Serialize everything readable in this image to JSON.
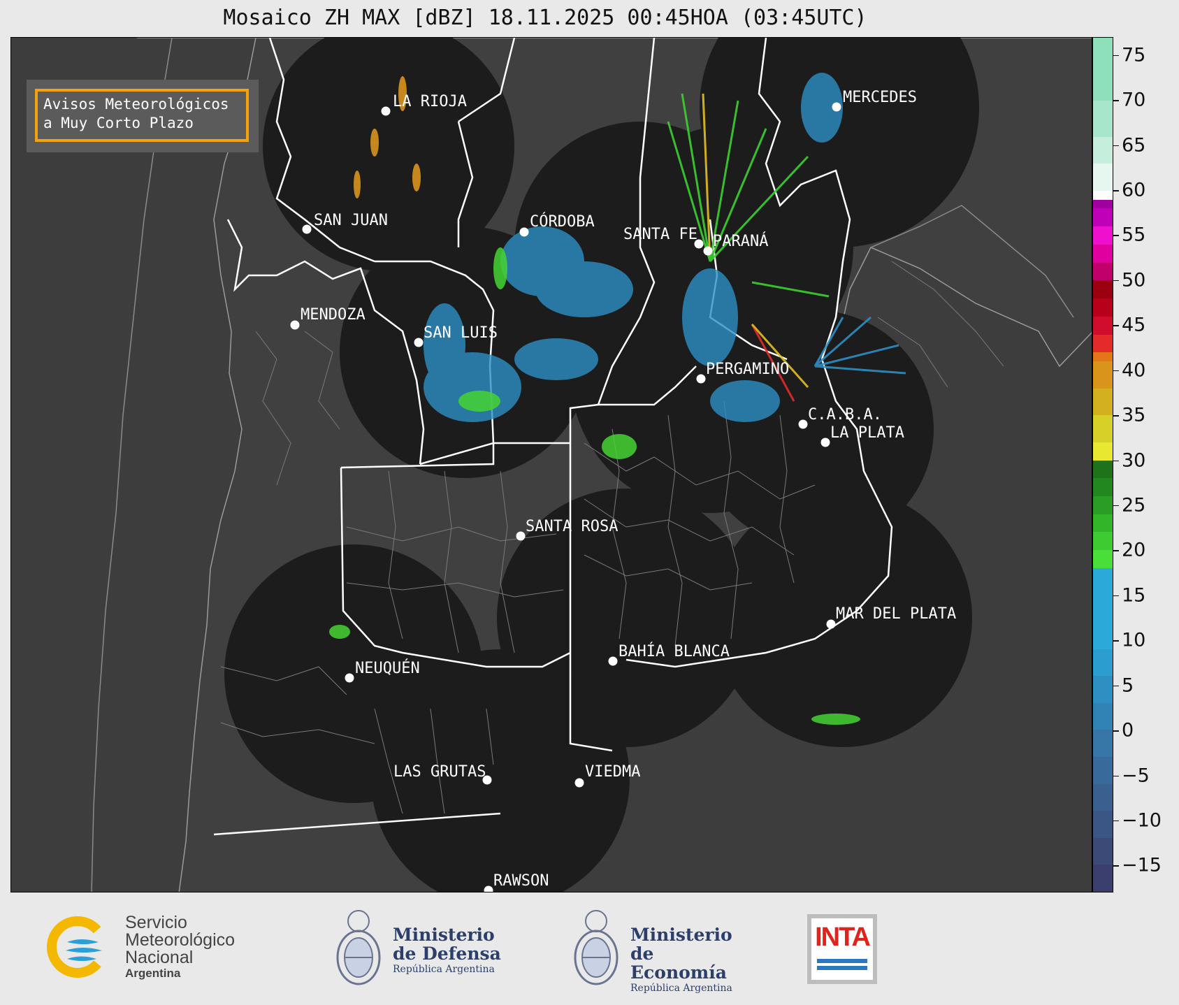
{
  "title": "Mosaico ZH MAX [dBZ] 18.11.2025 00:45HOA (03:45UTC)",
  "notice": {
    "line1": "Avisos Meteorológicos",
    "line2": "a Muy Corto Plazo",
    "border_color": "#f2a20c"
  },
  "cities": [
    {
      "name": "LA RIOJA"
    },
    {
      "name": "SAN JUAN"
    },
    {
      "name": "CÓRDOBA"
    },
    {
      "name": "SANTA FE"
    },
    {
      "name": "PARANÁ"
    },
    {
      "name": "MENDOZA"
    },
    {
      "name": "SAN LUIS"
    },
    {
      "name": "MERCEDES"
    },
    {
      "name": "PERGAMINO"
    },
    {
      "name": "C.A.B.A."
    },
    {
      "name": "LA PLATA"
    },
    {
      "name": "SANTA ROSA"
    },
    {
      "name": "MAR DEL PLATA"
    },
    {
      "name": "BAHÍA BLANCA"
    },
    {
      "name": "NEUQUÉN"
    },
    {
      "name": "LAS GRUTAS"
    },
    {
      "name": "VIEDMA"
    },
    {
      "name": "RAWSON"
    }
  ],
  "colorbar": {
    "min": -18,
    "max": 77,
    "ticks": [
      "75",
      "70",
      "65",
      "60",
      "55",
      "50",
      "45",
      "40",
      "35",
      "30",
      "25",
      "20",
      "15",
      "10",
      "5",
      "0",
      "−5",
      "−10",
      "−15"
    ],
    "tick_values": [
      75,
      70,
      65,
      60,
      55,
      50,
      45,
      40,
      35,
      30,
      25,
      20,
      15,
      10,
      5,
      0,
      -5,
      -10,
      -15
    ],
    "colors": [
      "#3a3f6e",
      "#3c4a78",
      "#3b5585",
      "#3a6090",
      "#386b9c",
      "#3677a8",
      "#3283b5",
      "#2e90c2",
      "#2b9dcf",
      "#2aaad9",
      "#4adf38",
      "#3ccb30",
      "#33b52a",
      "#2a9e24",
      "#23871f",
      "#1d721a",
      "#e8e830",
      "#d6d028",
      "#d2b020",
      "#d9941c",
      "#e4761a",
      "#e52a2a",
      "#d00d2d",
      "#b8001a",
      "#9b0010",
      "#c2006c",
      "#e000a0",
      "#ee10ce",
      "#c000b8",
      "#a000a0",
      "#ffffff",
      "#e6f7f0",
      "#c6eedd",
      "#a8e6cc",
      "#8ee0bb"
    ],
    "segment_ranges": [
      [
        -18,
        -15
      ],
      [
        -15,
        -12
      ],
      [
        -12,
        -9
      ],
      [
        -9,
        -6
      ],
      [
        -6,
        -3
      ],
      [
        -3,
        0
      ],
      [
        0,
        3
      ],
      [
        3,
        6
      ],
      [
        6,
        9
      ],
      [
        9,
        18
      ],
      [
        18,
        20
      ],
      [
        20,
        22
      ],
      [
        22,
        24
      ],
      [
        24,
        26
      ],
      [
        26,
        28
      ],
      [
        28,
        30
      ],
      [
        30,
        32
      ],
      [
        32,
        35
      ],
      [
        35,
        38
      ],
      [
        38,
        41
      ],
      [
        41,
        42
      ],
      [
        42,
        44
      ],
      [
        44,
        46
      ],
      [
        46,
        48
      ],
      [
        48,
        50
      ],
      [
        50,
        52
      ],
      [
        52,
        54
      ],
      [
        54,
        56
      ],
      [
        56,
        58
      ],
      [
        58,
        59
      ],
      [
        59,
        60
      ],
      [
        60,
        63
      ],
      [
        63,
        66
      ],
      [
        66,
        70
      ],
      [
        70,
        77
      ]
    ]
  },
  "footer": {
    "smn": {
      "line1": "Servicio",
      "line2": "Meteorológico",
      "line3": "Nacional",
      "line4": "Argentina"
    },
    "defensa": {
      "line1": "Ministerio",
      "line2": "de Defensa",
      "line3": "República Argentina"
    },
    "economia": {
      "line1": "Ministerio",
      "line2": "de Economía",
      "line3": "República Argentina"
    },
    "inta": {
      "label": "INTA"
    }
  }
}
